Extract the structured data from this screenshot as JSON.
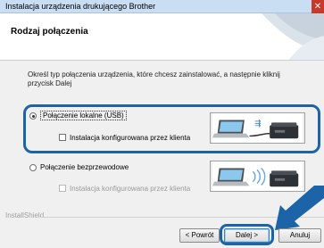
{
  "window": {
    "title": "Instalacja urządzenia drukującego Brother",
    "close_glyph": "✕"
  },
  "header": {
    "heading": "Rodzaj połączenia"
  },
  "description": "Określ typ połączenia urządzenia, które chcesz zainstalować, a następnie kliknij przycisk Dalej",
  "options": {
    "local": {
      "label": "Połączenie lokalne (USB)",
      "selected": true,
      "custom_install_label": "Instalacja konfigurowana przez klienta",
      "custom_install_checked": false,
      "icon": "usb-connection-icon"
    },
    "wireless": {
      "label": "Połączenie bezprzewodowe",
      "selected": false,
      "custom_install_label": "Instalacja konfigurowana przez klienta",
      "custom_install_checked": false,
      "custom_install_enabled": false,
      "icon": "wireless-connection-icon"
    }
  },
  "footer": {
    "brand": "InstallShield",
    "back_label": "< Powrót",
    "next_label": "Dalej >",
    "cancel_label": "Anuluj"
  },
  "colors": {
    "highlight": "#1d63a8",
    "titlebar": "#c9ddf3",
    "close": "#c7392b"
  }
}
